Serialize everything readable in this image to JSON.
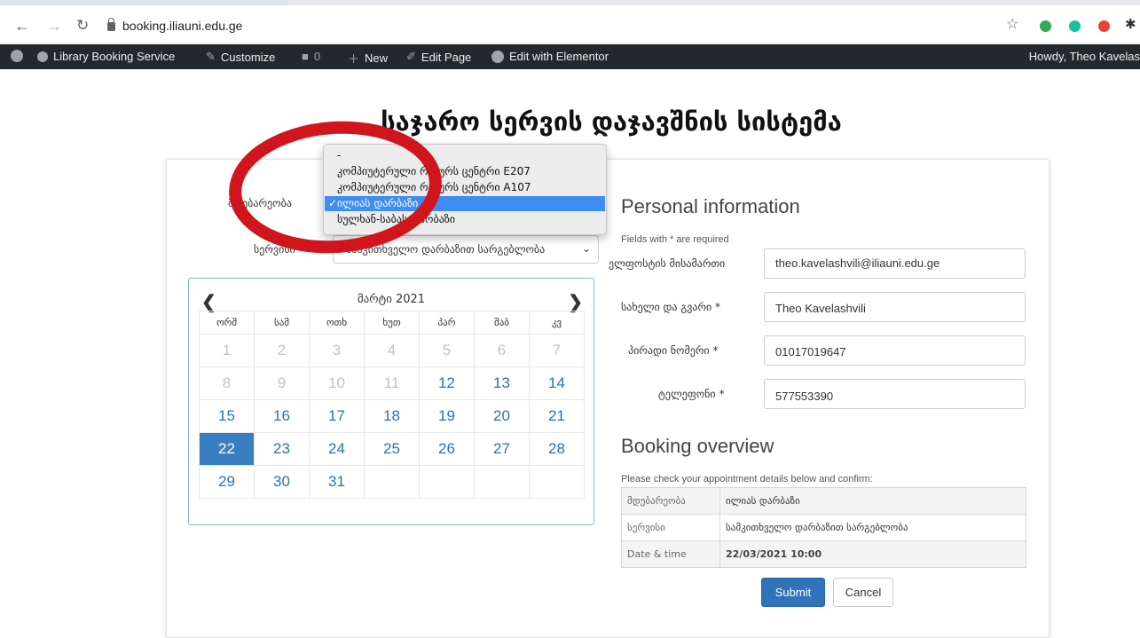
{
  "browser": {
    "url": "booking.iliauni.edu.ge"
  },
  "wp_bar": {
    "site": "Library Booking Service",
    "customize": "Customize",
    "comments": "0",
    "new": "New",
    "edit_page": "Edit Page",
    "elementor": "Edit with Elementor",
    "howdy": "Howdy, Theo Kavelas"
  },
  "page": {
    "title": "საჯარო სერვის დაჯავშნის სისტემა"
  },
  "form": {
    "location_label": "მდებარეობა",
    "service_label": "სერვისი",
    "service_value": "სამკითხველო დარბაზით სარგებლობა"
  },
  "dropdown": {
    "options": [
      {
        "label": "-"
      },
      {
        "label": "კომპიუტერული რესურს ცენტრი E207"
      },
      {
        "label": "კომპიუტერული რესურს ცენტრი A107"
      },
      {
        "label": "ილიას დარბაზი",
        "selected": true
      },
      {
        "label": "სულხან-საბას დარბაზი"
      }
    ]
  },
  "calendar": {
    "month": "მარტი 2021",
    "weekdays": [
      "ორშ",
      "სამ",
      "ოთხ",
      "ხუთ",
      "პარ",
      "შაბ",
      "კვ"
    ],
    "weeks": [
      [
        "1",
        "2",
        "3",
        "4",
        "5",
        "6",
        "7"
      ],
      [
        "8",
        "9",
        "10",
        "11",
        "12",
        "13",
        "14"
      ],
      [
        "15",
        "16",
        "17",
        "18",
        "19",
        "20",
        "21"
      ],
      [
        "22",
        "23",
        "24",
        "25",
        "26",
        "27",
        "28"
      ],
      [
        "29",
        "30",
        "31",
        "",
        "",
        "",
        ""
      ]
    ],
    "first_available": "12",
    "selected": "22"
  },
  "personal": {
    "heading": "Personal information",
    "required_note": "Fields with * are required",
    "email_label": "ელფოსტის მისამართი",
    "email_value": "theo.kavelashvili@iliauni.edu.ge",
    "name_label": "სახელი და გვარი *",
    "name_value": "Theo Kavelashvili",
    "id_label": "პირადი ნომერი *",
    "id_value": "01017019647",
    "phone_label": "ტელეფონი *",
    "phone_value": "577553390"
  },
  "overview": {
    "heading": "Booking overview",
    "note": "Please check your appointment details below and confirm:",
    "rows": [
      {
        "k": "მდებარეობა",
        "v": "ილიას დარბაზი"
      },
      {
        "k": "სერვისი",
        "v": "სამკითხველო დარბაზით სარგებლობა"
      },
      {
        "k": "Date & time",
        "v": "22/03/2021 10:00"
      }
    ]
  },
  "buttons": {
    "submit": "Submit",
    "cancel": "Cancel"
  },
  "colors": {
    "accent": "#3a7ec2",
    "annotation": "#d0161c"
  }
}
